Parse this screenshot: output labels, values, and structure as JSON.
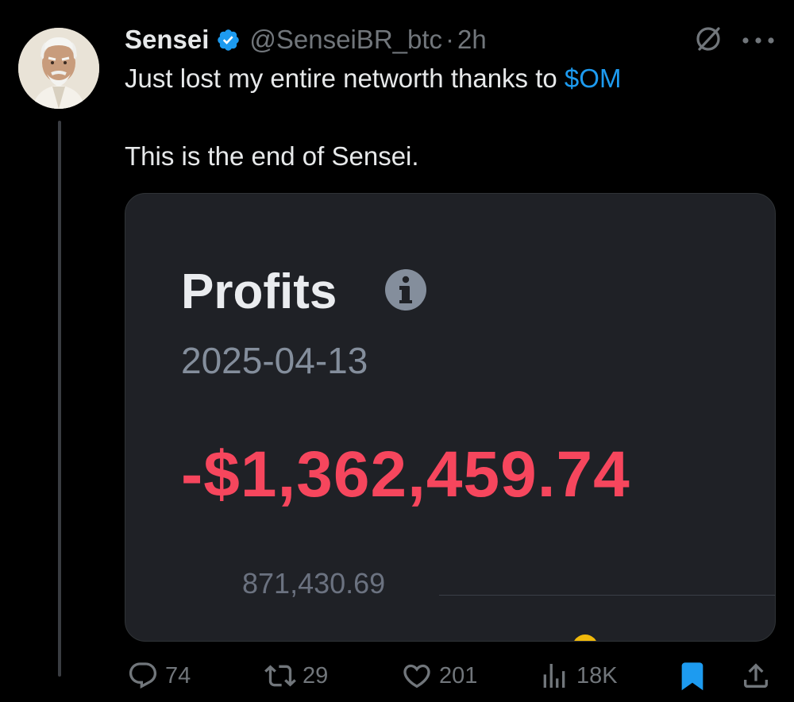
{
  "tweet": {
    "author_name": "Sensei",
    "handle": "@SenseiBR_btc",
    "separator": "·",
    "time": "2h",
    "text_line1_prefix": "Just lost my entire networth thanks to ",
    "cashtag": "$OM",
    "text_line2": "This is the end of Sensei.",
    "verified": true
  },
  "card": {
    "title": "Profits",
    "date": "2025-04-13",
    "profit": "-$1,362,459.74",
    "sub_value": "871,430.69"
  },
  "actions": {
    "replies": "74",
    "reposts": "29",
    "likes": "201",
    "views": "18K",
    "bookmarked": true
  },
  "colors": {
    "accent": "#1d9bf0",
    "loss": "#f6465d",
    "muted": "#71767b"
  }
}
